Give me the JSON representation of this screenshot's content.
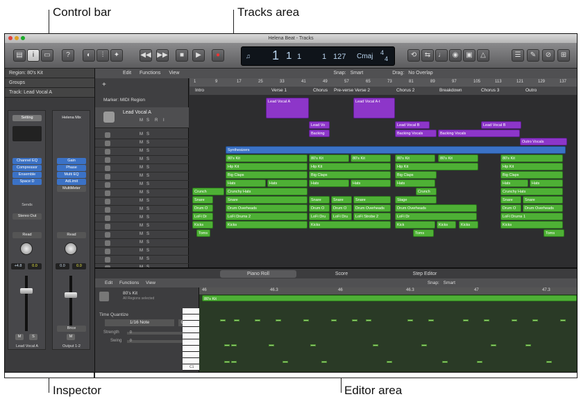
{
  "annotations": {
    "control_bar": "Control bar",
    "tracks_area": "Tracks area",
    "inspector": "Inspector",
    "editor_area": "Editor area"
  },
  "window": {
    "title": "Helena Beat - Tracks"
  },
  "lcd": {
    "bar": "1",
    "beat": "1",
    "div": "1",
    "tick": "1",
    "tempo": "127",
    "key": "Cmaj",
    "sig_top": "4",
    "sig_bottom": "4"
  },
  "inspector": {
    "rows": [
      "Region: 80's Kit",
      "Groups",
      "Track: Lead Vocal A"
    ],
    "strip1": {
      "setting": "Setting",
      "eq": "Channel EQ",
      "comp": "Compressor",
      "ens": "Ensemble",
      "send": "Space D",
      "sends": "Sends",
      "out": "Stereo Out",
      "read": "Read",
      "vals": [
        "+4.8",
        "0.0"
      ],
      "name": "Lead Vocal A"
    },
    "strip2": {
      "setting": "Helena Mix",
      "eq": "Gain",
      "comp": "Phase",
      "ens": "Multi EQ",
      "send": "AdLimit",
      "multimeter": "MultiMeter",
      "read": "Read",
      "vals": [
        "0.0",
        "0.0"
      ],
      "bnce": "Bnce",
      "name": "Output 1-2"
    }
  },
  "tracks_menu": {
    "edit": "Edit",
    "functions": "Functions",
    "view": "View",
    "snap_label": "Snap:",
    "snap": "Smart",
    "drag_label": "Drag:",
    "drag": "No Overlap"
  },
  "marker_label": "Marker: MIDI Region",
  "ruler": [
    "1",
    "9",
    "17",
    "25",
    "33",
    "41",
    "49",
    "57",
    "65",
    "73",
    "81",
    "89",
    "97",
    "105",
    "113",
    "121",
    "129",
    "137"
  ],
  "markers": [
    "Intro",
    "Verse 1",
    "Chorus",
    "Pre-verse",
    "Verse 2",
    "Chorus 2",
    "Breakdown",
    "Chorus 3",
    "Outro"
  ],
  "track_header": {
    "name": "Lead Vocal A",
    "m": "M",
    "s": "S",
    "r": "R",
    "i": "I"
  },
  "regions": {
    "lead_vocal": "Lead Vocal A",
    "lead_vocal_2": "Lead Vocal A-t",
    "lead_vo": "Lead Vo",
    "lead_vocal_b": "Lead Vocal B",
    "lead_vocal_b2": "Lead Vocal B",
    "backing": "Backing",
    "backing_vocals": "Backing Vocals",
    "backing_vocals2": "Backing Vocals",
    "outro_vocals": "Outro Vocals",
    "synth": "Synthesizers",
    "kit": "80's Kit",
    "hip": "Hip Kit",
    "big": "Big Claps",
    "hats": "Hats",
    "crunch": "Crunch",
    "crunchy": "Crunchy Hats",
    "snare": "Snare",
    "drum_o": "Drum O",
    "drum_over": "Drum Overheads",
    "lofi": "LoFi Drums 2",
    "lofi_dr": "LoFi Dru",
    "lofi_d": "LoFi Dr",
    "lofi_strobe": "LoFi Strobe 2",
    "lofi_drums1": "LoFi Drums 1",
    "kicks": "Kicks",
    "kick": "Kick",
    "toms": "Toms",
    "stage": "Stage"
  },
  "editor": {
    "tabs": [
      "Piano Roll",
      "Score",
      "Step Editor"
    ],
    "edit": "Edit",
    "functions": "Functions",
    "view": "View",
    "snap_label": "Snap:",
    "snap": "Smart",
    "ruler": [
      "46",
      "46.3",
      "46",
      "46.3",
      "47",
      "47.3"
    ],
    "region_name": "80's Kit",
    "region_sub": "All Regions selected",
    "time_q": "Time Quantize",
    "q_value": "1/16 Note",
    "q_btn": "Q",
    "strength": "Strength",
    "swing": "Swing",
    "strength_val": "0",
    "swing_val": "0",
    "c1": "C1"
  },
  "colors": {
    "green": "#4eb035",
    "purple": "#8d36c9",
    "blue": "#3b72c6"
  }
}
